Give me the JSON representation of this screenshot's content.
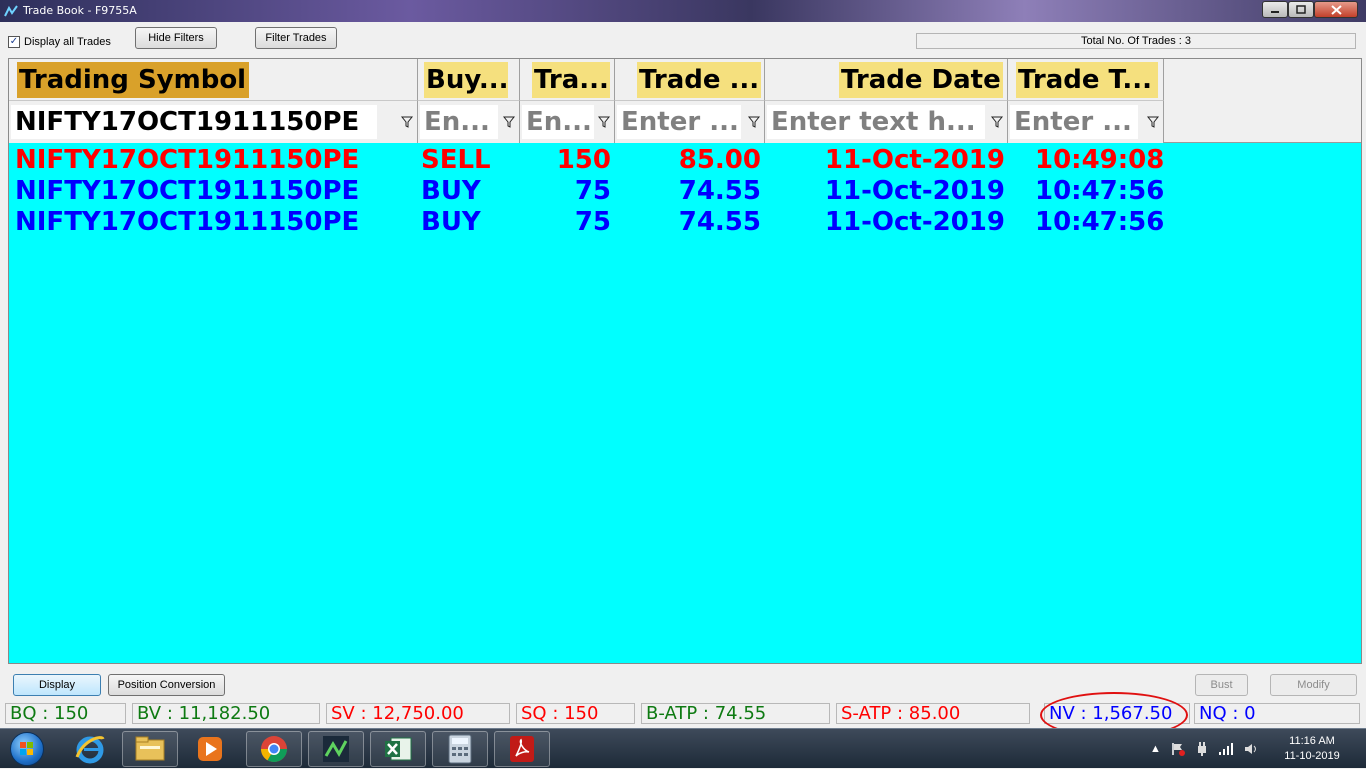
{
  "window": {
    "title": "Trade Book - F9755A"
  },
  "toolbar": {
    "display_all_label": "Display all Trades",
    "display_all_checked": true,
    "hide_filters": "Hide Filters",
    "filter_trades": "Filter Trades",
    "total_trades": "Total No. Of Trades : 3"
  },
  "grid": {
    "columns": [
      "Trading Symbol",
      "Buy...",
      "Tra...",
      "Trade ...",
      "Trade Date",
      "Trade T..."
    ],
    "filters": [
      "NIFTY17OCT1911150PE",
      "En...",
      "En...",
      "Enter ...",
      "Enter text h...",
      "Enter ..."
    ],
    "rows": [
      {
        "side": "sell",
        "symbol": "NIFTY17OCT1911150PE",
        "buysell": "SELL",
        "qty": "150",
        "price": "85.00",
        "date": "11-Oct-2019",
        "time": "10:49:08"
      },
      {
        "side": "buy",
        "symbol": "NIFTY17OCT1911150PE",
        "buysell": "BUY",
        "qty": "75",
        "price": "74.55",
        "date": "11-Oct-2019",
        "time": "10:47:56"
      },
      {
        "side": "buy",
        "symbol": "NIFTY17OCT1911150PE",
        "buysell": "BUY",
        "qty": "75",
        "price": "74.55",
        "date": "11-Oct-2019",
        "time": "10:47:56"
      }
    ],
    "colors": {
      "background": "#00ffff",
      "sell": "#ff0000",
      "buy": "#0000ff",
      "header": "#f5e07e",
      "header_active": "#d9a12a"
    }
  },
  "actions": {
    "display": "Display",
    "position_conversion": "Position Conversion",
    "bust": "Bust",
    "modify": "Modify"
  },
  "status": {
    "bq": "BQ : 150",
    "bv": "BV : 11,182.50",
    "sv": "SV : 12,750.00",
    "sq": "SQ : 150",
    "batp": "B-ATP : 74.55",
    "satp": "S-ATP : 85.00",
    "nv": "NV : 1,567.50",
    "nq": "NQ : 0"
  },
  "taskbar": {
    "icons": [
      "internet-explorer-icon",
      "file-explorer-icon",
      "media-player-icon",
      "chrome-icon",
      "trading-app-icon",
      "excel-icon",
      "calculator-icon",
      "acrobat-icon"
    ],
    "time": "11:16 AM",
    "date": "11-10-2019"
  }
}
